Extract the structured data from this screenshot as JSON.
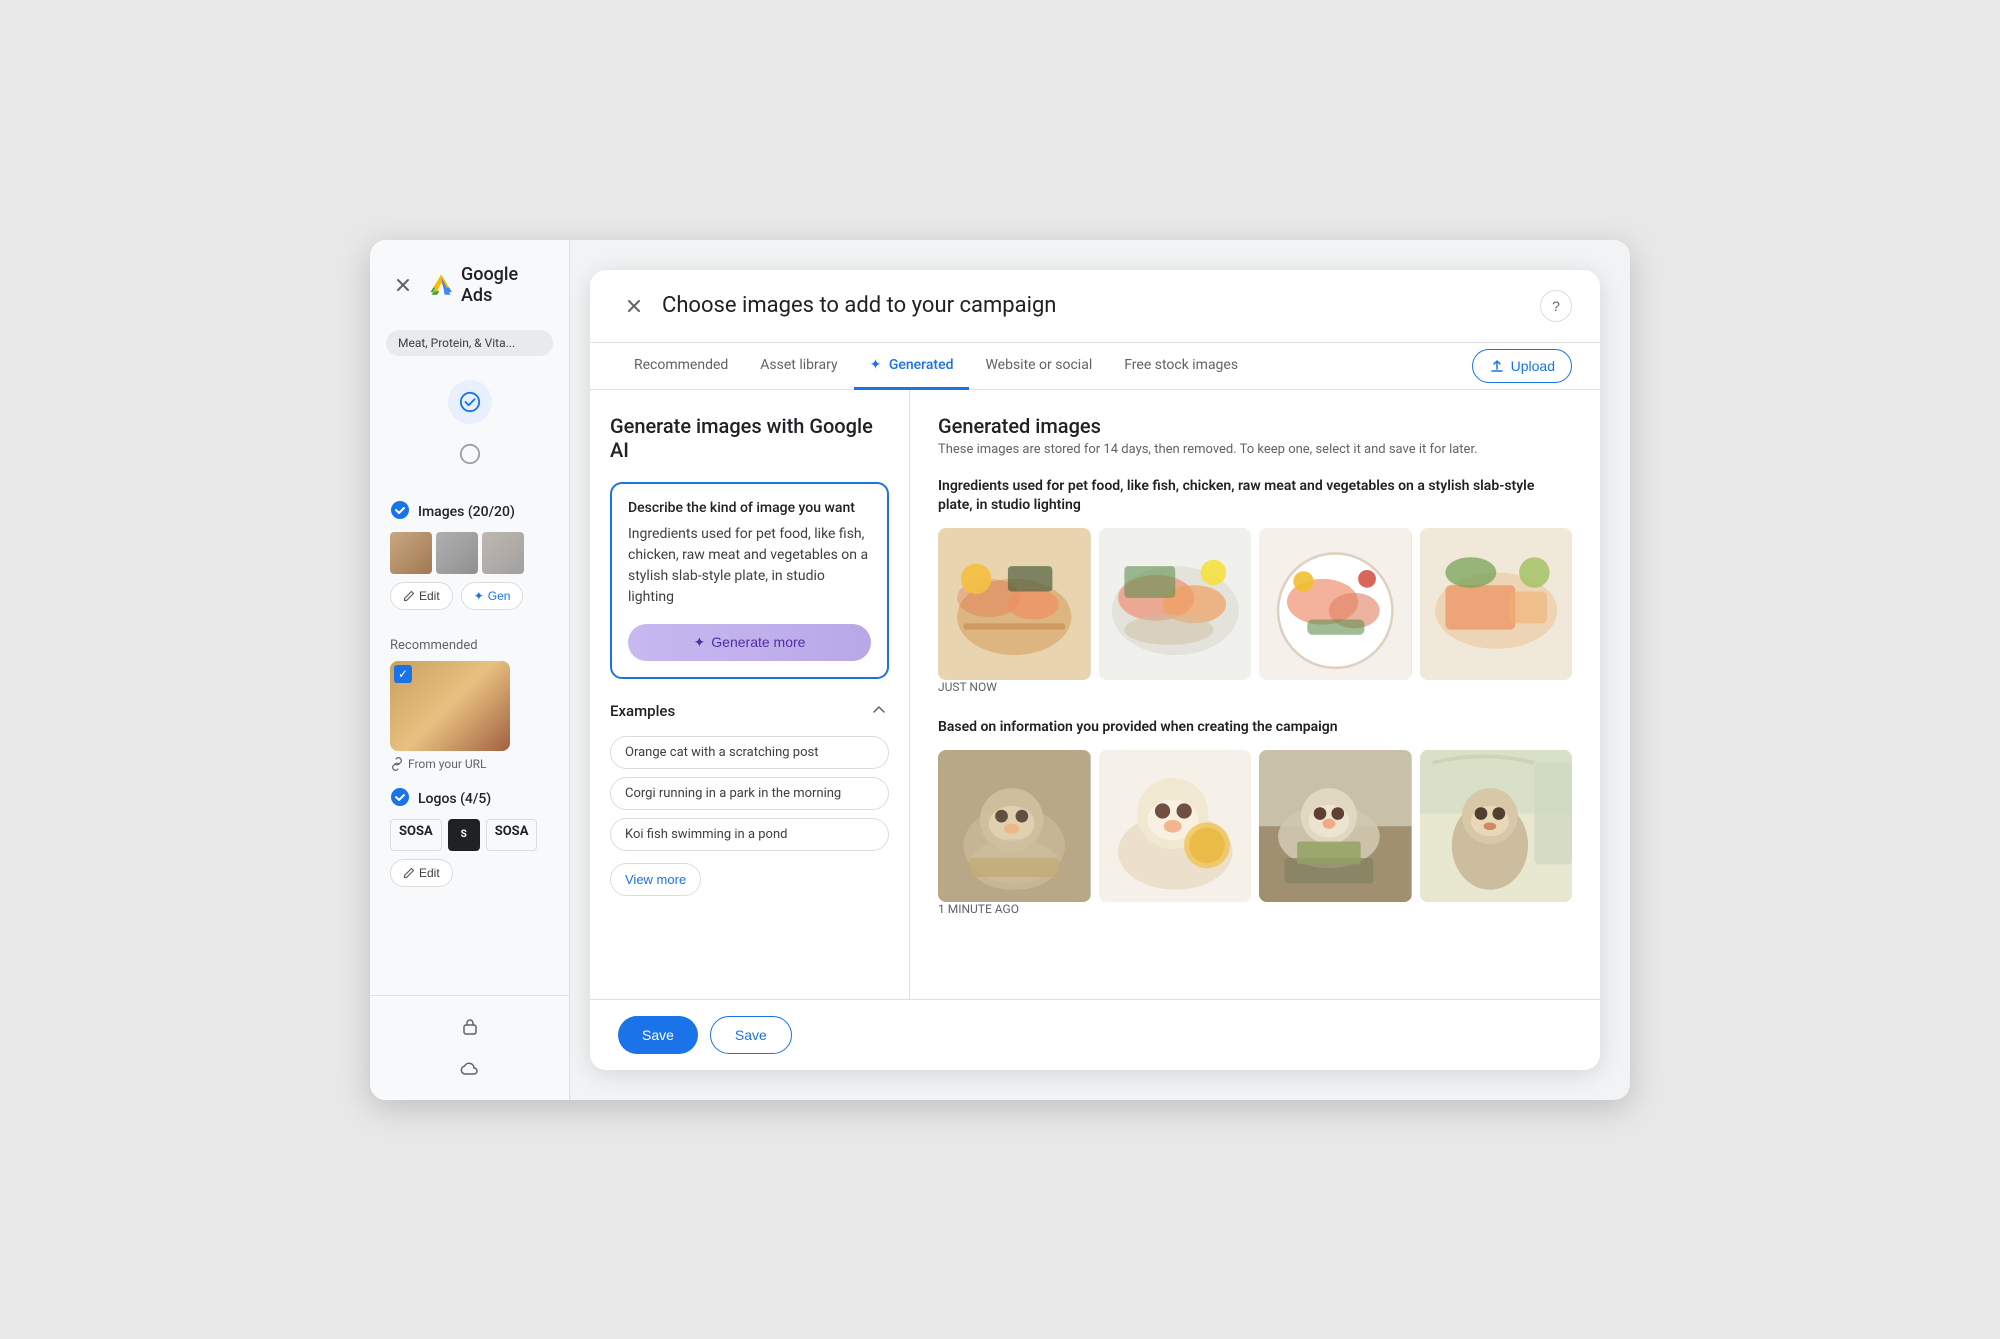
{
  "sidebar": {
    "close_label": "×",
    "app_name": "Google Ads",
    "tag": "Meat, Protein, & Vita...",
    "images_section": {
      "title": "Images (20/20)",
      "edit_btn": "Edit",
      "generate_btn": "Gen"
    },
    "recommended_label": "Recommended",
    "from_url_label": "From your URL",
    "logos_section": {
      "title": "Logos (4/5)",
      "edit_btn": "Edit"
    },
    "bottom_icons": [
      "lock-icon",
      "cloud-icon"
    ]
  },
  "modal": {
    "title": "Choose images to add to your campaign",
    "close_label": "×",
    "help_label": "?",
    "tabs": [
      {
        "id": "recommended",
        "label": "Recommended",
        "active": false
      },
      {
        "id": "asset-library",
        "label": "Asset library",
        "active": false
      },
      {
        "id": "generated",
        "label": "Generated",
        "active": true,
        "icon": "✦"
      },
      {
        "id": "website-social",
        "label": "Website or social",
        "active": false
      },
      {
        "id": "free-stock",
        "label": "Free stock images",
        "active": false
      }
    ],
    "upload_btn": "Upload",
    "generate_panel": {
      "title": "Generate images with Google AI",
      "textarea_label": "Describe the kind of image you want",
      "textarea_value": "Ingredients used for pet food, like fish, chicken, raw meat and vegetables on a stylish slab-style plate, in studio lighting",
      "generate_btn": "Generate more",
      "examples_title": "Examples",
      "examples": [
        "Orange cat with a scratching post",
        "Corgi running in a park in the morning",
        "Koi fish swimming in a pond"
      ],
      "view_more_btn": "View more"
    },
    "generated_panel": {
      "title": "Generated images",
      "subtitle": "These images are stored for 14 days, then removed. To keep one, select it and save it for later.",
      "sections": [
        {
          "id": "just-now",
          "label": "Ingredients used for pet food, like fish, chicken, raw meat and vegetables on a stylish slab-style plate, in studio lighting",
          "timestamp": "JUST NOW",
          "images": [
            "food1",
            "food2",
            "food3",
            "food4"
          ]
        },
        {
          "id": "one-min-ago",
          "label": "Based on information you provided when creating the campaign",
          "timestamp": "1 MINUTE AGO",
          "images": [
            "cat1",
            "cat2",
            "cat3",
            "cat4"
          ]
        }
      ]
    },
    "footer": {
      "save_btn": "Save",
      "save_btn2": "Save"
    }
  }
}
